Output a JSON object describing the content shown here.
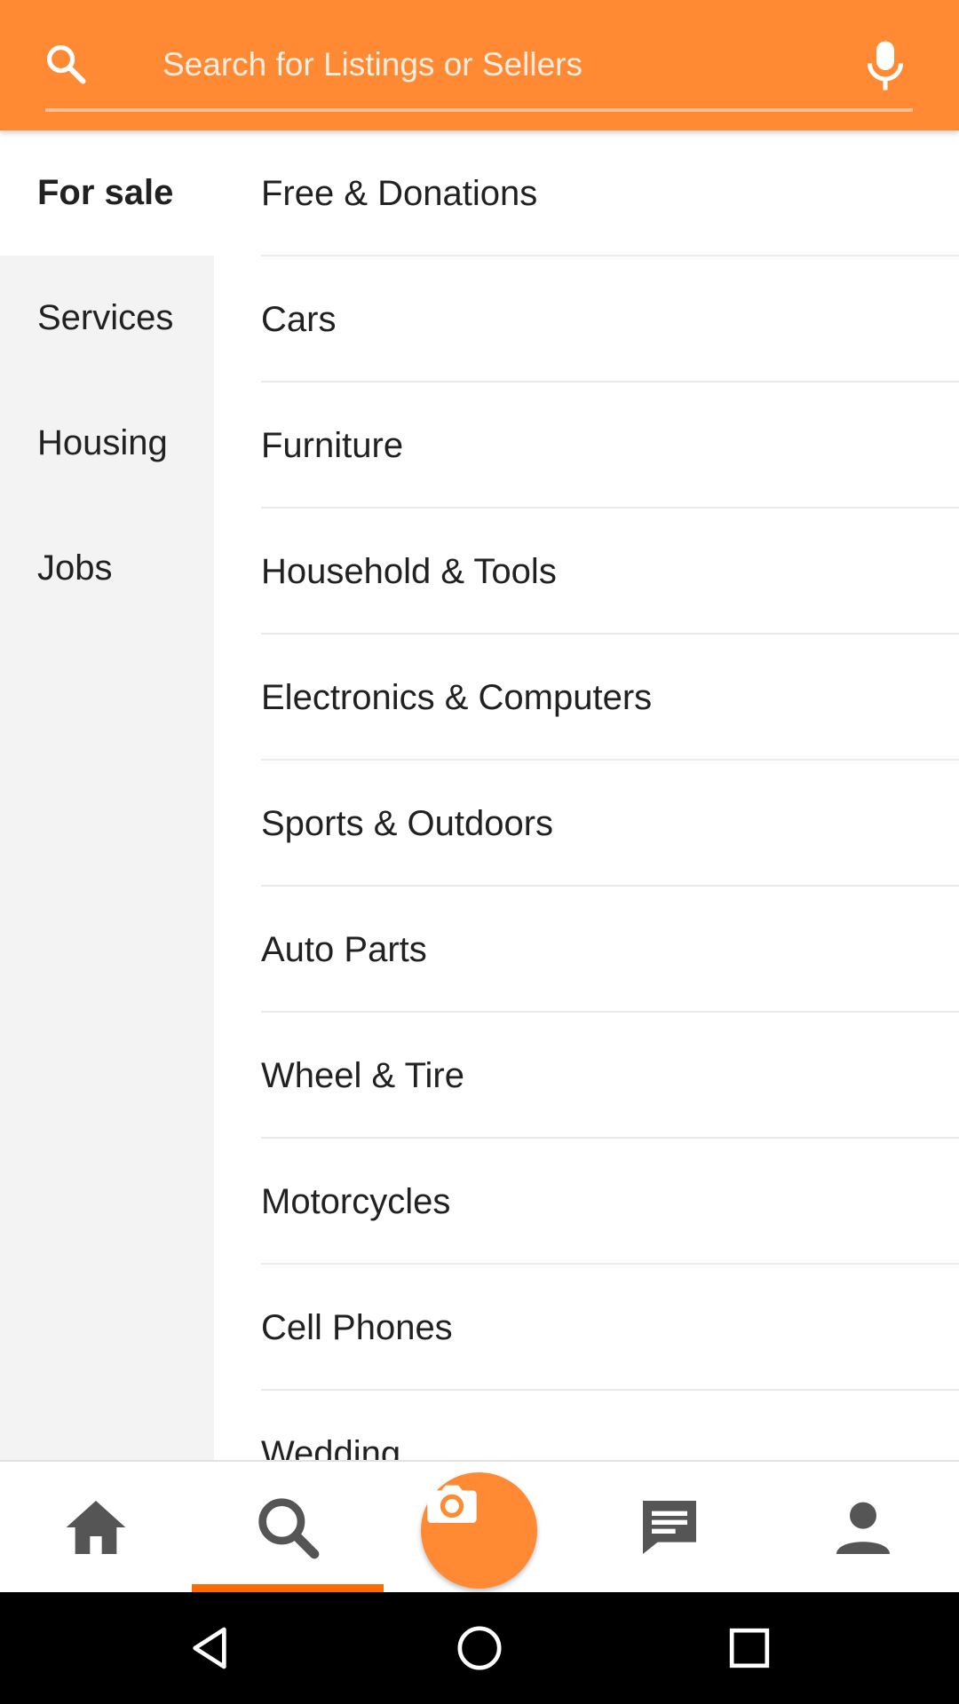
{
  "search": {
    "placeholder": "Search for Listings or Sellers",
    "icon": "search-icon",
    "voice_icon": "microphone-icon"
  },
  "categories": [
    {
      "label": "For sale",
      "active": true
    },
    {
      "label": "Services",
      "active": false
    },
    {
      "label": "Housing",
      "active": false
    },
    {
      "label": "Jobs",
      "active": false
    }
  ],
  "subcategories": [
    "Free & Donations",
    "Cars",
    "Furniture",
    "Household & Tools",
    "Electronics & Computers",
    "Sports & Outdoors",
    "Auto Parts",
    "Wheel & Tire",
    "Motorcycles",
    "Cell Phones",
    "Wedding"
  ],
  "bottom_nav": {
    "items": [
      "home-icon",
      "search-icon",
      "camera-icon",
      "chat-icon",
      "profile-icon"
    ],
    "selected": "search-icon"
  },
  "system_nav": [
    "back-icon",
    "home-circle-icon",
    "recents-icon"
  ],
  "colors": {
    "accent": "#FF8A33",
    "indicator": "#FF6A00",
    "sidebar_bg": "#F3F3F3",
    "text": "#212121",
    "icon_gray": "#555555"
  }
}
